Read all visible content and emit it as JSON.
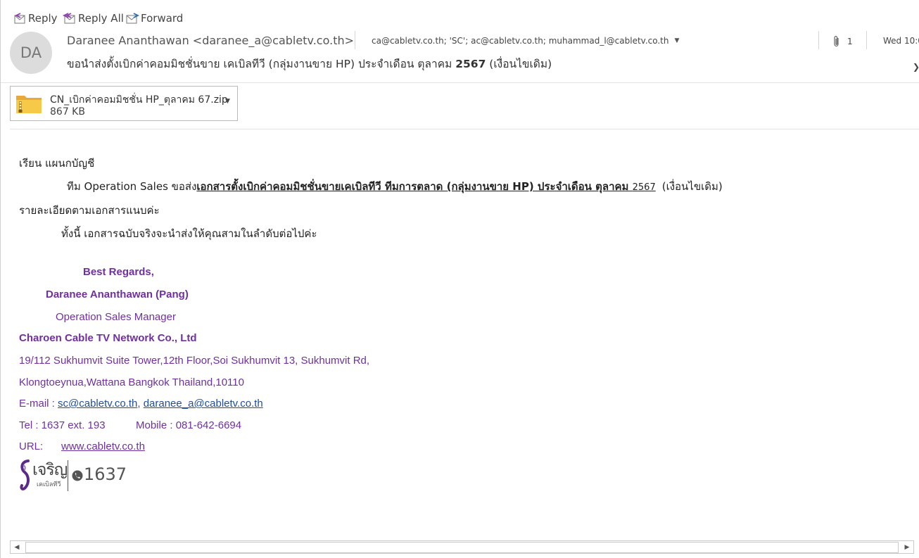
{
  "toolbar": {
    "reply": "Reply",
    "reply_all": "Reply All",
    "forward": "Forward"
  },
  "header": {
    "avatar_initials": "DA",
    "sender": "Daranee Ananthawan <daranee_a@cabletv.co.th>",
    "recipients": "ca@cabletv.co.th; 'SC'; ac@cabletv.co.th; muhammad_l@cabletv.co.th",
    "attachment_count": "1",
    "date": "Wed 10:0",
    "subject_pre": "ขอนำส่งตั้งเบิกค่าคอมมิชชั่นขาย เคเบิลทีวี (กลุ่มงานขาย HP) ประจำเดือน ตุลาคม ",
    "subject_bold": "2567",
    "subject_post": " (เงื่อนไขเดิม)"
  },
  "attachment": {
    "name": "CN_เบิกค่าคอมมิชชั่น HP_ตุลาคม 67.zip",
    "size": "867 KB"
  },
  "body": {
    "greeting": "เรียน แผนกบัญชี",
    "line1_pre": "ทีม Operation Sales ขอส่ง",
    "line1_ul": "เอกสารตั้งเบิกค่าคอมมิชชั่นขายเคเบิลทีวี ทีมการตลาด (กลุ่มงานขาย HP) ประจำเดือน ตุลาคม ",
    "line1_ul_year": "2567",
    "line1_post": "(เงื่อนไขเดิม)",
    "line2": "รายละเอียดตามเอกสารแนบค่ะ",
    "line3": "ทั้งนี้ เอกสารฉบับจริงจะนำส่งให้คุณสามในลำดับต่อไปค่ะ"
  },
  "signature": {
    "regards": "Best Regards,",
    "name": "Daranee Ananthawan (Pang)",
    "title": "Operation Sales Manager",
    "company": "Charoen Cable TV Network Co., Ltd",
    "address1": "19/112 Sukhumvit Suite Tower,12th Floor,Soi Sukhumvit 13, Sukhumvit Rd,",
    "address2": "Klongtoeynua,Wattana Bangkok Thailand,10110",
    "email_label": "E-mail : ",
    "email1": "sc@cabletv.co.th",
    "email_sep": ", ",
    "email2": "daranee_a@cabletv.co.th",
    "tel": "Tel : 1637 ext. 193",
    "mobile": "Mobile :  081-642-6694",
    "url_label": "URL:",
    "url": "www.cabletv.co.th",
    "logo_text_th": "เจริญ",
    "logo_sub_th": "เคเบิลทีวี",
    "logo_number": "1637"
  },
  "colors": {
    "signature": "#7030a0",
    "link": "#1f4e9e"
  }
}
